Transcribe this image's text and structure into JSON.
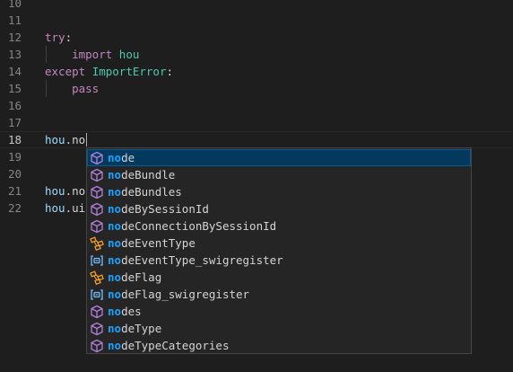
{
  "editor": {
    "lines": [
      {
        "num": "10",
        "tokens": []
      },
      {
        "num": "11",
        "tokens": []
      },
      {
        "num": "12",
        "tokens": [
          {
            "t": "try",
            "c": "kw"
          },
          {
            "t": ":",
            "c": "plain"
          }
        ]
      },
      {
        "num": "13",
        "tokens": [
          {
            "t": "    ",
            "c": "plain"
          },
          {
            "t": "import",
            "c": "kw"
          },
          {
            "t": " ",
            "c": "plain"
          },
          {
            "t": "hou",
            "c": "mod"
          }
        ]
      },
      {
        "num": "14",
        "tokens": [
          {
            "t": "except",
            "c": "kw"
          },
          {
            "t": " ",
            "c": "plain"
          },
          {
            "t": "ImportError",
            "c": "mod"
          },
          {
            "t": ":",
            "c": "plain"
          }
        ]
      },
      {
        "num": "15",
        "tokens": [
          {
            "t": "    ",
            "c": "plain"
          },
          {
            "t": "pass",
            "c": "kw"
          }
        ]
      },
      {
        "num": "16",
        "tokens": []
      },
      {
        "num": "17",
        "tokens": []
      },
      {
        "num": "18",
        "tokens": [
          {
            "t": "hou",
            "c": "id"
          },
          {
            "t": ".no",
            "c": "plain"
          }
        ],
        "active": true
      },
      {
        "num": "19",
        "tokens": []
      },
      {
        "num": "20",
        "tokens": []
      },
      {
        "num": "21",
        "tokens": [
          {
            "t": "hou",
            "c": "id"
          },
          {
            "t": ".no",
            "c": "plain"
          }
        ]
      },
      {
        "num": "22",
        "tokens": [
          {
            "t": "hou",
            "c": "id"
          },
          {
            "t": ".ui",
            "c": "plain"
          }
        ]
      }
    ]
  },
  "suggestions": {
    "match_prefix": "no",
    "selected_index": 0,
    "items": [
      {
        "prefix": "no",
        "rest": "de",
        "kind": "module-icon"
      },
      {
        "prefix": "no",
        "rest": "deBundle",
        "kind": "module-icon"
      },
      {
        "prefix": "no",
        "rest": "deBundles",
        "kind": "module-icon"
      },
      {
        "prefix": "no",
        "rest": "deBySessionId",
        "kind": "module-icon"
      },
      {
        "prefix": "no",
        "rest": "deConnectionBySessionId",
        "kind": "module-icon"
      },
      {
        "prefix": "no",
        "rest": "deEventType",
        "kind": "class-icon"
      },
      {
        "prefix": "no",
        "rest": "deEventType_swigregister",
        "kind": "variable-icon"
      },
      {
        "prefix": "no",
        "rest": "deFlag",
        "kind": "class-icon"
      },
      {
        "prefix": "no",
        "rest": "deFlag_swigregister",
        "kind": "variable-icon"
      },
      {
        "prefix": "no",
        "rest": "des",
        "kind": "module-icon"
      },
      {
        "prefix": "no",
        "rest": "deType",
        "kind": "module-icon"
      },
      {
        "prefix": "no",
        "rest": "deTypeCategories",
        "kind": "module-icon"
      }
    ]
  },
  "colors": {
    "background": "#1e1e1e",
    "keyword": "#c586c0",
    "type": "#4ec9b0",
    "variable": "#9cdcfe",
    "match_highlight": "#18a3ff",
    "module_icon": "#b180d7",
    "class_icon": "#ee9d28",
    "variable_icon": "#75beff",
    "selection": "#04395e"
  }
}
